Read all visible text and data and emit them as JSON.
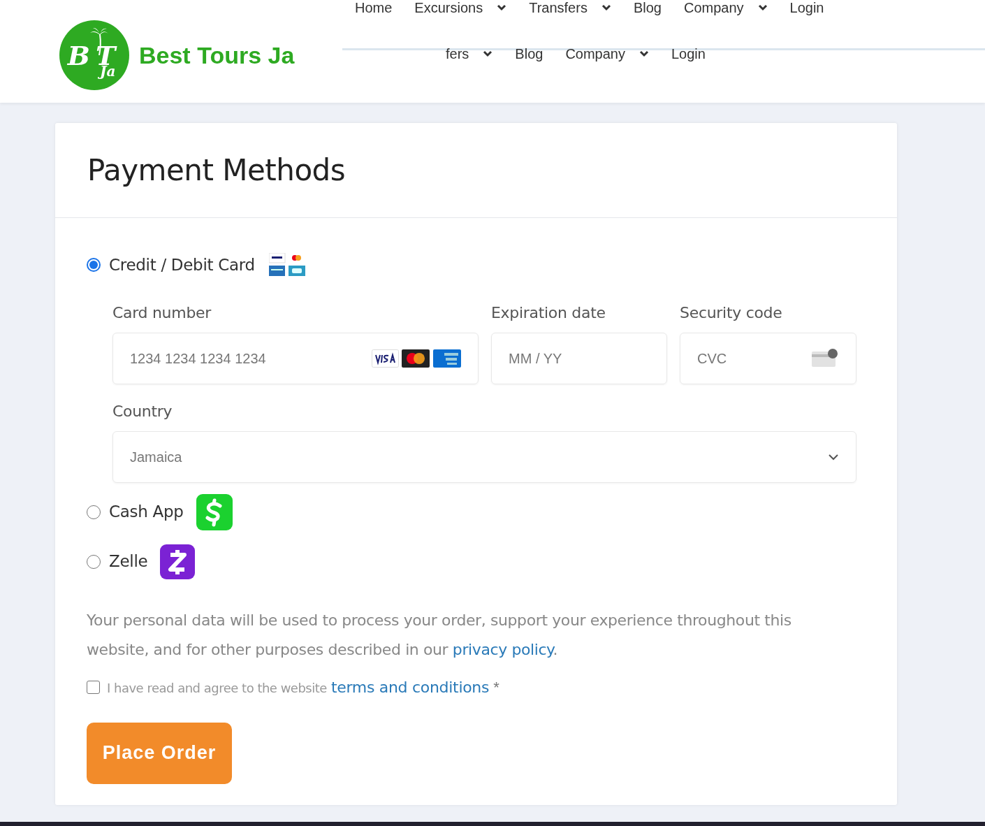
{
  "header": {
    "logo": {
      "mark": "BT",
      "sub": "Ja",
      "name": "Best Tours Ja"
    },
    "nav_top": [
      {
        "label": "Home",
        "dropdown": false
      },
      {
        "label": "Excursions",
        "dropdown": true
      },
      {
        "label": "Transfers",
        "dropdown": true
      },
      {
        "label": "Blog",
        "dropdown": false
      },
      {
        "label": "Company",
        "dropdown": true
      },
      {
        "label": "Login",
        "dropdown": false
      }
    ],
    "nav_second": [
      {
        "label": "fers",
        "dropdown": true
      },
      {
        "label": "Blog",
        "dropdown": false
      },
      {
        "label": "Company",
        "dropdown": true
      },
      {
        "label": "Login",
        "dropdown": false
      }
    ]
  },
  "payment": {
    "title": "Payment Methods",
    "methods": [
      {
        "kind": "card",
        "label": "Credit / Debit Card",
        "selected": true
      },
      {
        "kind": "cashapp",
        "label": "Cash App",
        "selected": false
      },
      {
        "kind": "zelle",
        "label": "Zelle",
        "selected": false
      }
    ],
    "card_form": {
      "card_number": {
        "label": "Card number",
        "placeholder": "1234 1234 1234 1234"
      },
      "expiry": {
        "label": "Expiration date",
        "placeholder": "MM / YY"
      },
      "security": {
        "label": "Security code",
        "placeholder": "CVC"
      },
      "country": {
        "label": "Country",
        "value": "Jamaica"
      }
    },
    "privacy": {
      "text": "Your personal data will be used to process your order, support your experience throughout this website, and for other purposes described in our",
      "link": "privacy policy",
      "end": "."
    },
    "terms": {
      "checked": false,
      "text": "I have read and agree to the website",
      "link": "terms and conditions",
      "required": "*"
    },
    "button": "Place Order"
  }
}
